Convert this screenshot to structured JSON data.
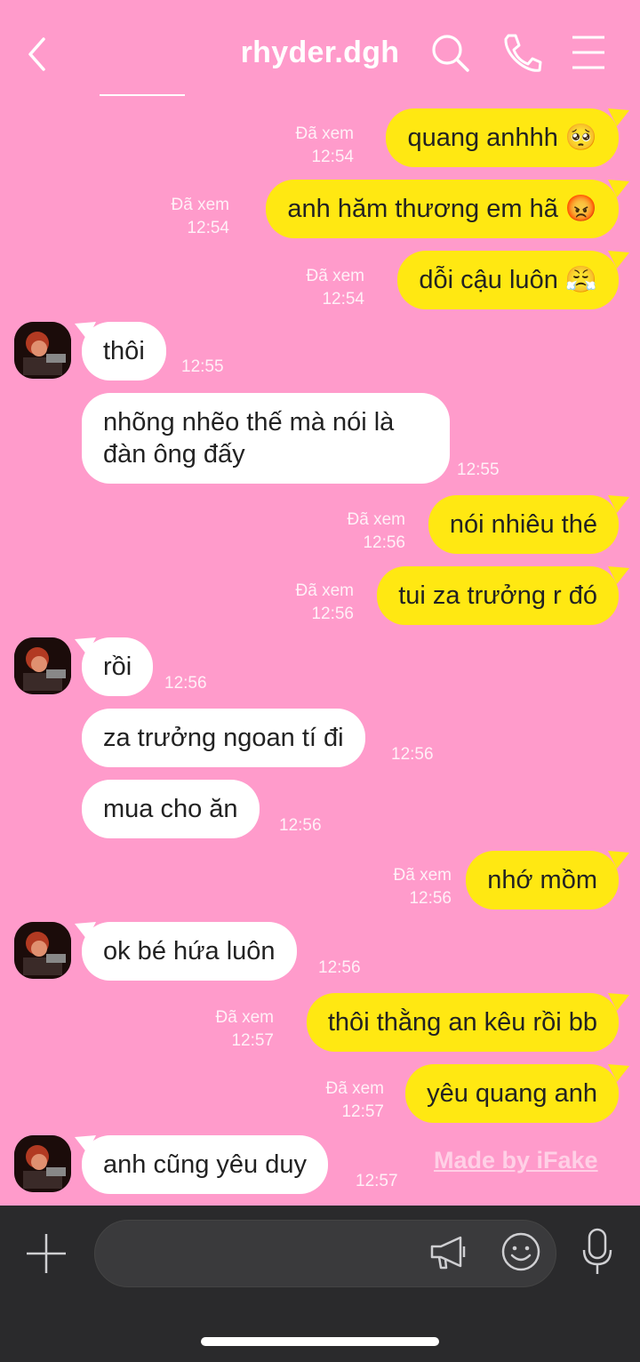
{
  "header": {
    "title": "rhyder.dgh"
  },
  "messages": [
    {
      "dir": "out",
      "text": "quang anhhh 🥺",
      "status": "Đã xem",
      "time": "12:54"
    },
    {
      "dir": "out",
      "text": "anh hăm thương em hã 😡",
      "status": "Đã xem",
      "time": "12:54"
    },
    {
      "dir": "out",
      "text": "dỗi cậu luôn 😤",
      "status": "Đã xem",
      "time": "12:54"
    },
    {
      "dir": "in",
      "text": "thôi",
      "time": "12:55",
      "avatar": true
    },
    {
      "dir": "in",
      "text": "nhõng nhẽo thế mà nói là đàn ông đấy",
      "time": "12:55"
    },
    {
      "dir": "out",
      "text": "nói nhiêu thé",
      "status": "Đã xem",
      "time": "12:56"
    },
    {
      "dir": "out",
      "text": "tui za trưởng r đó",
      "status": "Đã xem",
      "time": "12:56"
    },
    {
      "dir": "in",
      "text": "rồi",
      "time": "12:56",
      "avatar": true
    },
    {
      "dir": "in",
      "text": "za trưởng ngoan tí đi",
      "time": "12:56"
    },
    {
      "dir": "in",
      "text": "mua cho ăn",
      "time": "12:56"
    },
    {
      "dir": "out",
      "text": "nhớ mồm",
      "status": "Đã xem",
      "time": "12:56"
    },
    {
      "dir": "in",
      "text": "ok bé hứa luôn",
      "time": "12:56",
      "avatar": true
    },
    {
      "dir": "out",
      "text": "thôi thằng an kêu rồi bb",
      "status": "Đã xem",
      "time": "12:57"
    },
    {
      "dir": "out",
      "text": "yêu quang anh",
      "status": "Đã xem",
      "time": "12:57"
    },
    {
      "dir": "in",
      "text": "anh cũng yêu duy",
      "time": "12:57",
      "avatar": true
    }
  ],
  "watermark": "Made by iFake",
  "colors": {
    "background": "#ff9bcb",
    "outgoing": "#ffe812",
    "incoming": "#ffffff",
    "input_bar": "#2a2a2c"
  },
  "icons": [
    "back-chevron-icon",
    "search-icon",
    "phone-icon",
    "menu-icon",
    "plus-icon",
    "megaphone-icon",
    "emoji-icon",
    "mic-icon"
  ]
}
